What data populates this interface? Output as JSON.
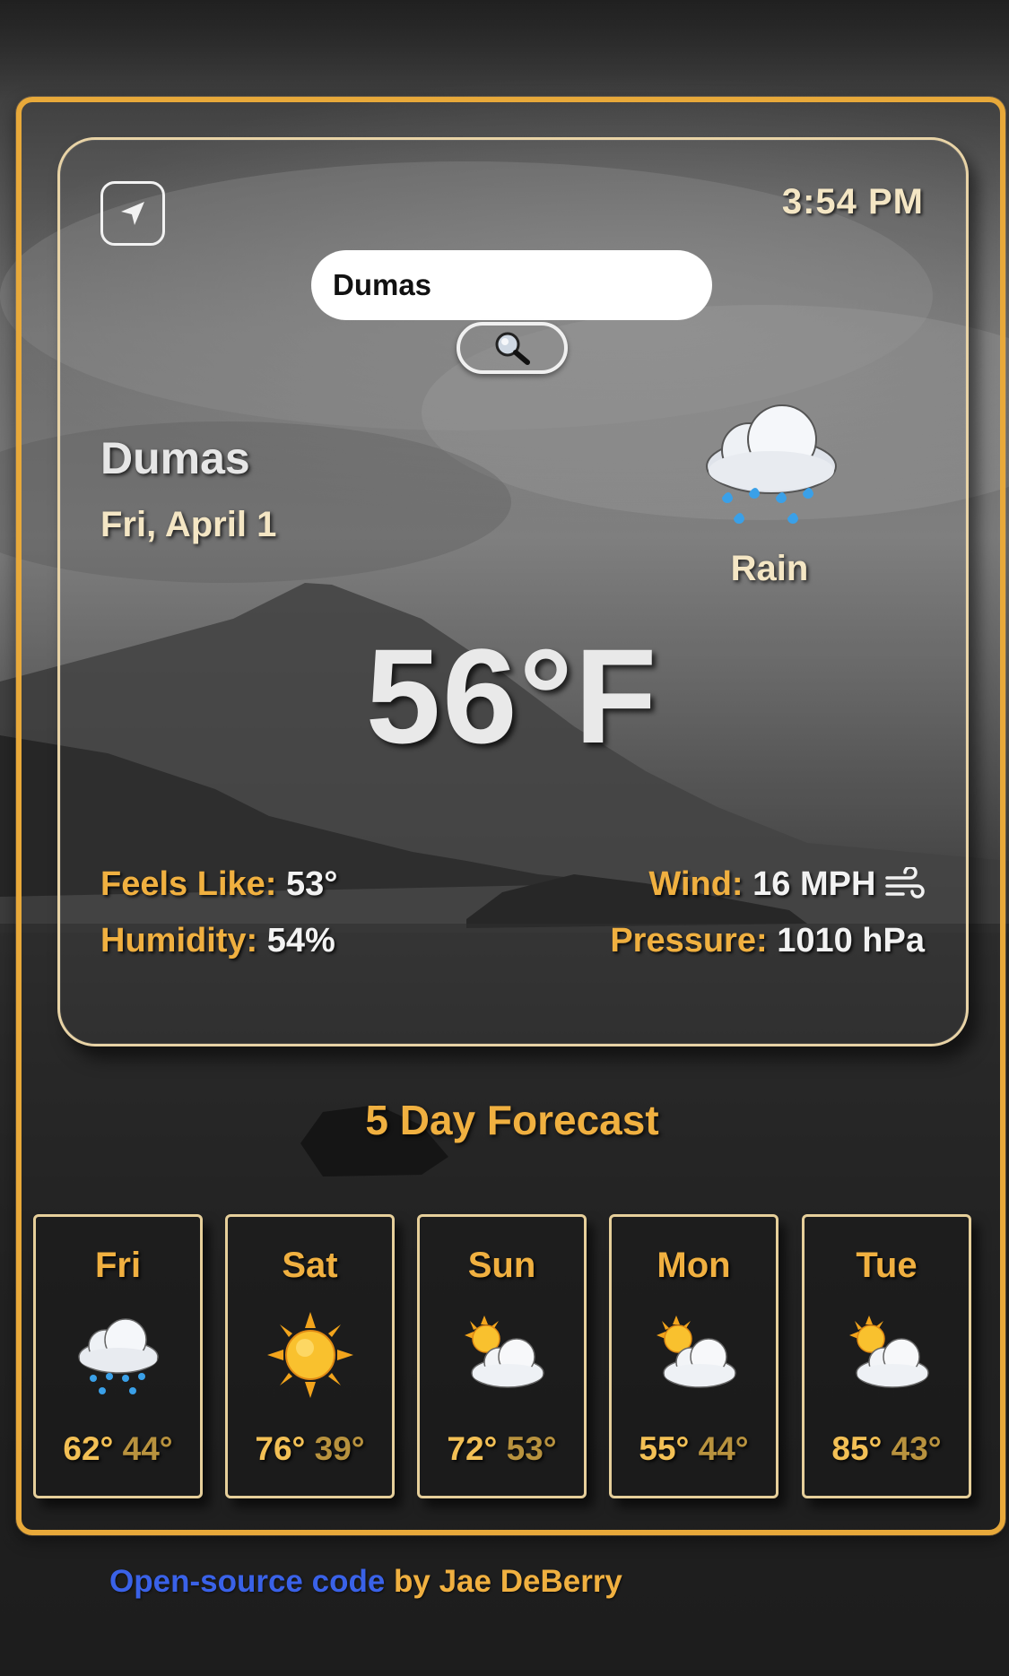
{
  "header": {
    "time": "3:54 PM",
    "locate_icon": "location-arrow-icon"
  },
  "search": {
    "value": "Dumas",
    "button_icon": "magnifying-glass-icon"
  },
  "current": {
    "city": "Dumas",
    "date": "Fri, April 1",
    "condition": "Rain",
    "condition_icon": "rain-cloud-icon",
    "temperature": "56°F",
    "feels_like_label": "Feels Like:",
    "feels_like_value": "53°",
    "humidity_label": "Humidity:",
    "humidity_value": "54%",
    "wind_label": "Wind:",
    "wind_value": "16 MPH",
    "wind_icon": "wind-icon",
    "pressure_label": "Pressure:",
    "pressure_value": "1010 hPa"
  },
  "forecast": {
    "title": "5 Day Forecast",
    "days": [
      {
        "day": "Fri",
        "icon": "rain-cloud-icon",
        "high": "62°",
        "low": "44°"
      },
      {
        "day": "Sat",
        "icon": "sun-icon",
        "high": "76°",
        "low": "39°"
      },
      {
        "day": "Sun",
        "icon": "partly-cloudy-icon",
        "high": "72°",
        "low": "53°"
      },
      {
        "day": "Mon",
        "icon": "partly-cloudy-icon",
        "high": "55°",
        "low": "44°"
      },
      {
        "day": "Tue",
        "icon": "partly-cloudy-icon",
        "high": "85°",
        "low": "43°"
      }
    ]
  },
  "footer": {
    "link_text": "Open-source code",
    "byline": " by Jae DeBerry"
  },
  "colors": {
    "accent": "#f0b040",
    "frame": "#e8a93a",
    "link": "#3a62e8"
  }
}
